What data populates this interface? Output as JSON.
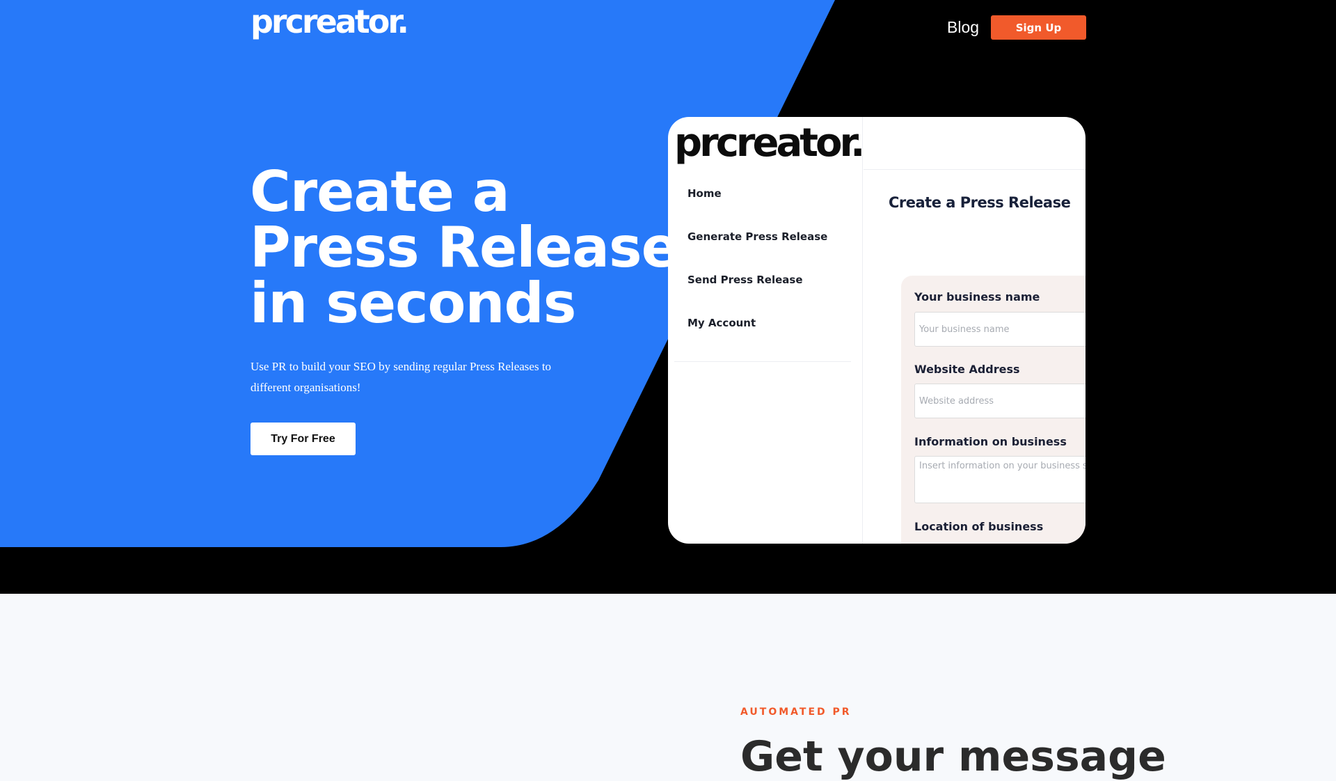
{
  "brand": {
    "logo_text": "prcreator.",
    "colors": {
      "hero_blue": "#2779f9",
      "accent_orange": "#f15a2b",
      "black": "#000000"
    }
  },
  "nav": {
    "blog_label": "Blog",
    "signup_label": "Sign Up"
  },
  "hero": {
    "headline": "Create a Press Release in seconds",
    "subtext": "Use PR to build your SEO by sending regular Press Releases to different organisations!",
    "cta_label": "Try For Free"
  },
  "mockup": {
    "logo_text": "prcreator.",
    "sidebar_items": [
      {
        "label": "Home"
      },
      {
        "label": "Generate Press Release"
      },
      {
        "label": "Send Press Release"
      },
      {
        "label": "My Account"
      }
    ],
    "page_title": "Create a Press Release",
    "form": {
      "business_name_label": "Your business name",
      "business_name_placeholder": "Your business name",
      "website_label": "Website Address",
      "website_placeholder": "Website address",
      "info_label": "Information on business",
      "info_placeholder": "Insert information on your business such as",
      "location_label": "Location of business"
    }
  },
  "feature": {
    "eyebrow": "AUTOMATED PR",
    "heading": "Get your message"
  }
}
